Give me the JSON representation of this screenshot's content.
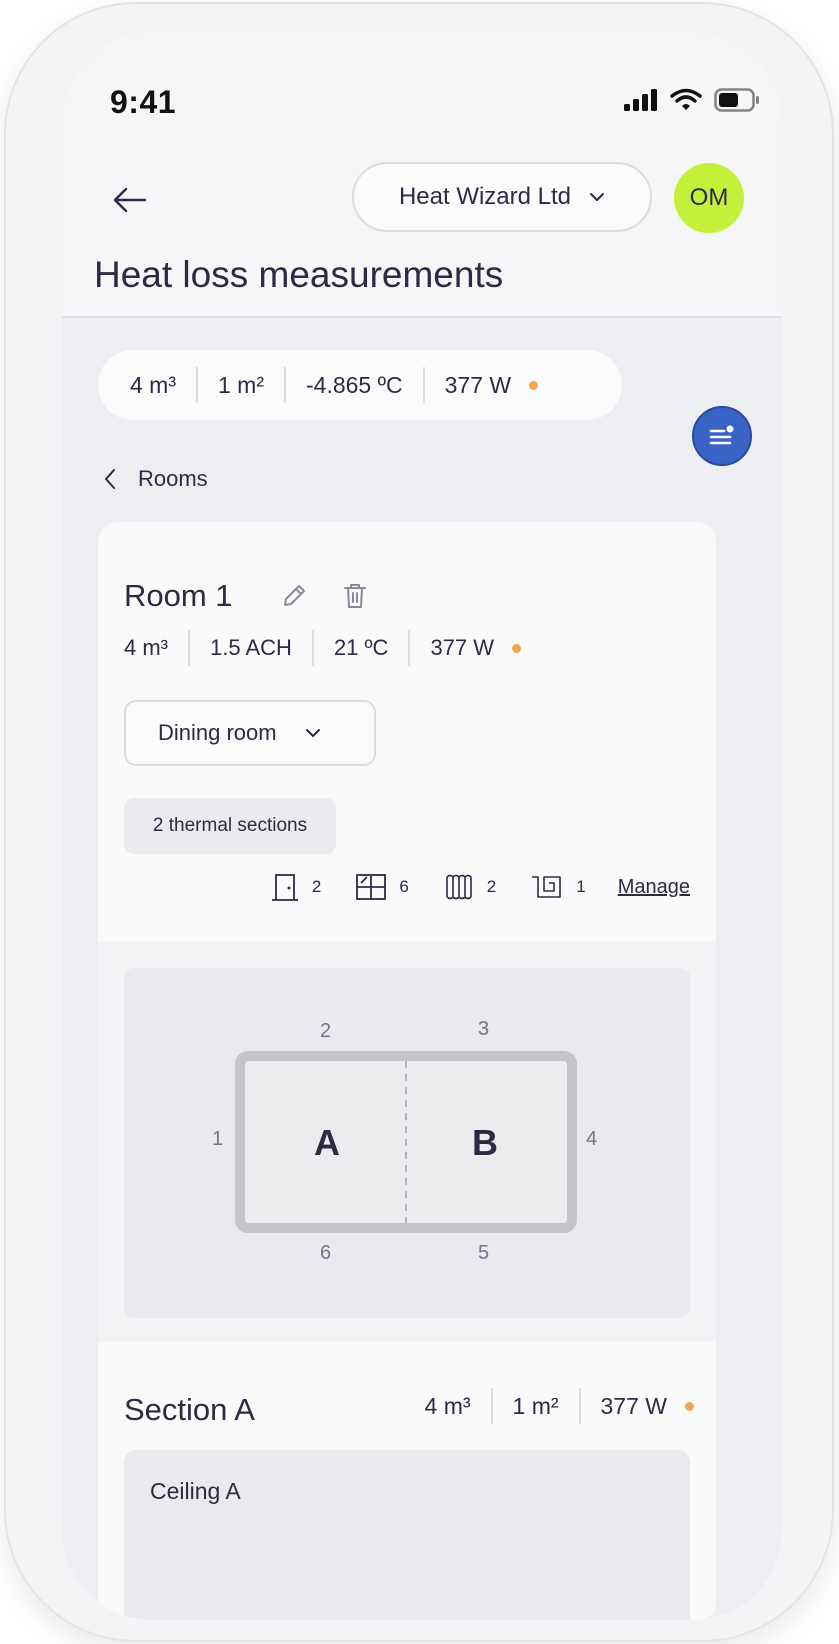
{
  "status_bar": {
    "time": "9:41"
  },
  "header": {
    "company": "Heat Wizard Ltd",
    "avatar_initials": "OM",
    "page_title": "Heat loss measurements"
  },
  "summary": {
    "volume": "4 m³",
    "area": "1 m²",
    "temperature": "-4.865 ºC",
    "power": "377 W"
  },
  "breadcrumb": {
    "label": "Rooms"
  },
  "room": {
    "title": "Room 1",
    "volume": "4 m³",
    "ach": "1.5 ACH",
    "temperature": "21 ºC",
    "power": "377 W",
    "room_type": "Dining room",
    "thermal_sections": "2 thermal sections",
    "elements": {
      "doors": "2",
      "windows": "6",
      "radiators": "2",
      "underfloor": "1"
    },
    "manage_label": "Manage"
  },
  "diagram": {
    "walls": [
      "1",
      "2",
      "3",
      "4",
      "5",
      "6"
    ],
    "sections": [
      "A",
      "B"
    ]
  },
  "section": {
    "title": "Section A",
    "volume": "4 m³",
    "area": "1 m²",
    "power": "377 W",
    "ceiling_title": "Ceiling A"
  },
  "colors": {
    "accent_dot": "#f0a850",
    "avatar_bg": "#c5f03a",
    "fab_bg": "#3a63c7"
  },
  "icons": [
    "back-arrow-icon",
    "chevron-down-icon",
    "menu-icon",
    "chevron-left-icon",
    "pencil-icon",
    "trash-icon",
    "door-icon",
    "window-icon",
    "radiator-icon",
    "underfloor-heating-icon",
    "signal-icon",
    "wifi-icon",
    "battery-icon"
  ]
}
